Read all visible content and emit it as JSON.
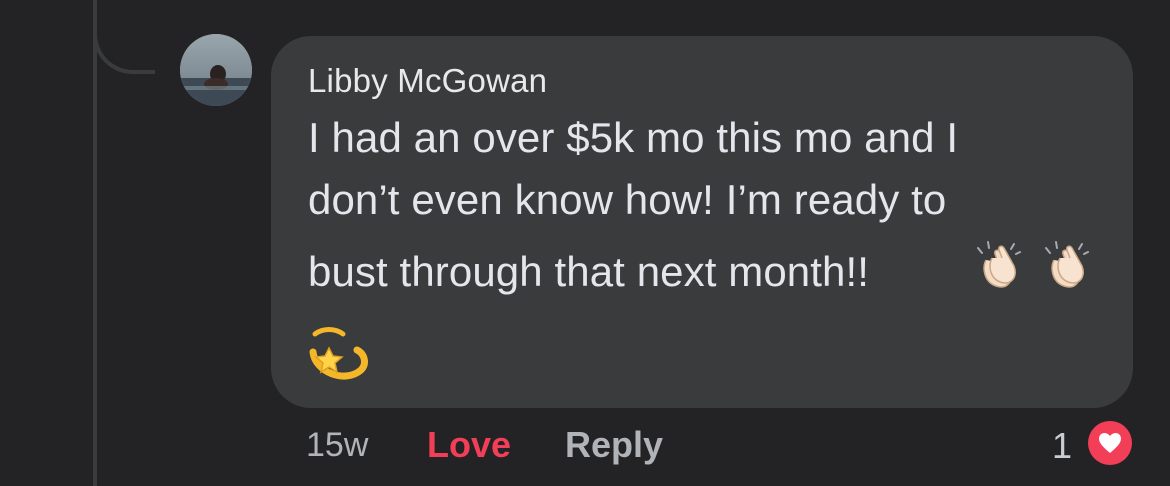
{
  "comment": {
    "author": "Libby McGowan",
    "text_lines": [
      "I had an over $5k mo this mo and I",
      "don’t even know how! I’m ready to",
      "bust through that next month!!"
    ],
    "emojis": [
      "clapping-hands",
      "clapping-hands",
      "dizzy-star"
    ]
  },
  "meta": {
    "time": "15w",
    "love_label": "Love",
    "reply_label": "Reply",
    "reaction_count": "1",
    "reaction_type": "heart-icon"
  },
  "colors": {
    "background": "#232325",
    "bubble": "#3a3b3d",
    "love_red": "#f33e58",
    "secondary_text": "#b0b3b8"
  }
}
